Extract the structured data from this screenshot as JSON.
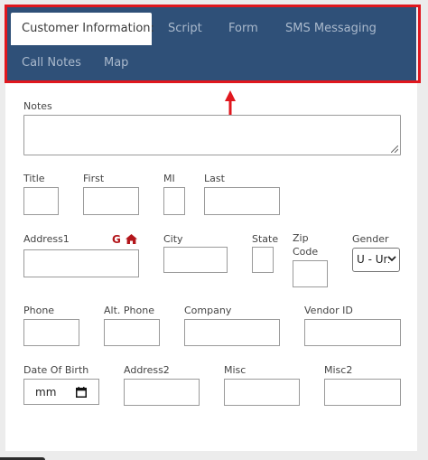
{
  "tabs": {
    "customer_info": "Customer Information:",
    "script": "Script",
    "form": "Form",
    "sms": "SMS Messaging",
    "call_notes": "Call Notes",
    "map": "Map"
  },
  "fields": {
    "notes": "Notes",
    "title": "Title",
    "first": "First",
    "mi": "MI",
    "last": "Last",
    "address1": "Address1",
    "city": "City",
    "state": "State",
    "zip_line1": "Zip",
    "zip_line2": "Code",
    "gender": "Gender",
    "gender_value": "U - Un",
    "phone": "Phone",
    "alt_phone": "Alt. Phone",
    "company": "Company",
    "vendor_id": "Vendor ID",
    "dob": "Date Of Birth",
    "dob_placeholder": "mm",
    "address2": "Address2",
    "misc": "Misc",
    "misc2": "Misc2"
  },
  "icons": {
    "g_letter": "G",
    "google": "google-icon",
    "home": "home-icon",
    "calendar": "calendar-icon"
  },
  "colors": {
    "tabbar": "#2f5078",
    "highlight": "#e0171e",
    "icon_red": "#b3161b"
  }
}
